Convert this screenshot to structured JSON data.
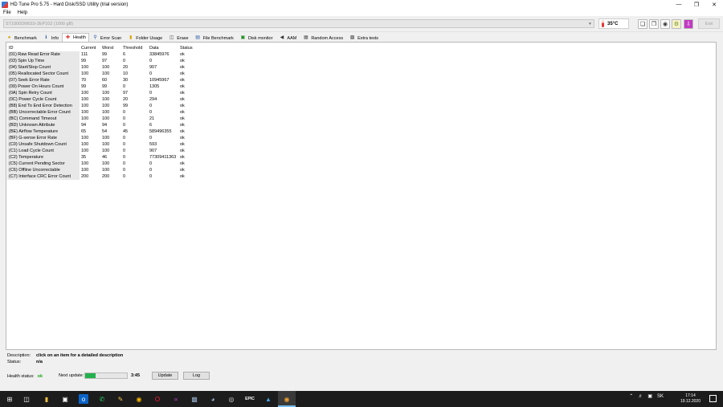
{
  "window": {
    "title": "HD Tune Pro 5.75 - Hard Disk/SSD Utility (trial version)"
  },
  "menu": {
    "file": "File",
    "help": "Help"
  },
  "device": {
    "drive": "ST1000DM010-2EP102 (1000 gB)",
    "temperature": "35°C",
    "exit_label": "Exit"
  },
  "tabs": [
    {
      "label": "Benchmark",
      "icon": "benchmark-icon"
    },
    {
      "label": "Info",
      "icon": "info-icon"
    },
    {
      "label": "Health",
      "icon": "health-cross-icon"
    },
    {
      "label": "Error Scan",
      "icon": "magnifier-icon"
    },
    {
      "label": "Folder Usage",
      "icon": "folder-icon"
    },
    {
      "label": "Erase",
      "icon": "erase-icon"
    },
    {
      "label": "File Benchmark",
      "icon": "file-icon"
    },
    {
      "label": "Disk monitor",
      "icon": "monitor-icon"
    },
    {
      "label": "AAM",
      "icon": "speaker-icon"
    },
    {
      "label": "Random Access",
      "icon": "random-icon"
    },
    {
      "label": "Extra tests",
      "icon": "extra-icon"
    }
  ],
  "table": {
    "headers": [
      "ID",
      "Current",
      "Worst",
      "Threshold",
      "Data",
      "Status"
    ],
    "rows": [
      [
        "(01) Raw Read Error Rate",
        "111",
        "99",
        "6",
        "33845976",
        "ok"
      ],
      [
        "(03) Spin Up Time",
        "99",
        "97",
        "0",
        "0",
        "ok"
      ],
      [
        "(04) Start/Stop Count",
        "100",
        "100",
        "20",
        "907",
        "ok"
      ],
      [
        "(05) Reallocated Sector Count",
        "100",
        "100",
        "10",
        "0",
        "ok"
      ],
      [
        "(07) Seek Error Rate",
        "70",
        "60",
        "30",
        "10945967",
        "ok"
      ],
      [
        "(09) Power On Hours Count",
        "99",
        "99",
        "0",
        "1305",
        "ok"
      ],
      [
        "(0A) Spin Retry Count",
        "100",
        "100",
        "97",
        "0",
        "ok"
      ],
      [
        "(0C) Power Cycle Count",
        "100",
        "100",
        "20",
        "294",
        "ok"
      ],
      [
        "(B8) End To End Error Detection",
        "100",
        "100",
        "99",
        "0",
        "ok"
      ],
      [
        "(BB) Uncorrectable Error Count",
        "100",
        "100",
        "0",
        "0",
        "ok"
      ],
      [
        "(BC) Command Timeout",
        "100",
        "100",
        "0",
        "21",
        "ok"
      ],
      [
        "(BD) Unknown Attribute",
        "94",
        "94",
        "0",
        "6",
        "ok"
      ],
      [
        "(BE) Airflow Temperature",
        "65",
        "54",
        "45",
        "589496355",
        "ok"
      ],
      [
        "(BF) G-sense Error Rate",
        "100",
        "100",
        "0",
        "0",
        "ok"
      ],
      [
        "(C0) Unsafe Shutdown Count",
        "100",
        "100",
        "0",
        "593",
        "ok"
      ],
      [
        "(C1) Load Cycle Count",
        "100",
        "100",
        "0",
        "907",
        "ok"
      ],
      [
        "(C2) Temperature",
        "35",
        "46",
        "0",
        "77309411363",
        "ok"
      ],
      [
        "(C5) Current Pending Sector",
        "100",
        "100",
        "0",
        "0",
        "ok"
      ],
      [
        "(C6) Offline Uncorrectable",
        "100",
        "100",
        "0",
        "0",
        "ok"
      ],
      [
        "(C7) Interface CRC Error Count",
        "200",
        "200",
        "0",
        "0",
        "ok"
      ]
    ]
  },
  "description": {
    "label": "Description:",
    "value": "click on an item for a detailed description",
    "status_label": "Status:",
    "status_value": "n/a"
  },
  "health": {
    "label": "Health status:",
    "value": "ok",
    "next_label": "Next update:",
    "progress": 0.25,
    "countdown": "3:45",
    "update_label": "Update",
    "log_label": "Log"
  },
  "taskbar": {
    "time": "17:14",
    "date": "19.12.2020",
    "lang": "SK"
  },
  "colors": {
    "ok": "#1aa51a",
    "progress": "#22b14c",
    "taskbar": "#1c1c1c"
  }
}
